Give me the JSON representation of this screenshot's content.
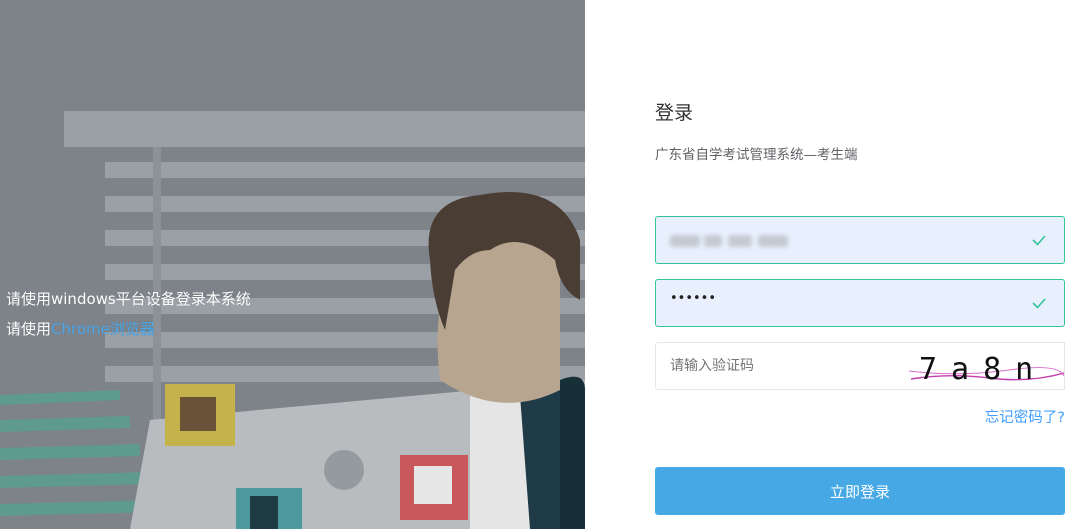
{
  "notice": {
    "line1": "请使用windows平台设备登录本系统",
    "line2_prefix": "请使用",
    "line2_link": "Chrome浏览器"
  },
  "form": {
    "title": "登录",
    "subtitle": "广东省自学考试管理系统—考生端",
    "username_value": "",
    "password_value": "••••••",
    "captcha_placeholder": "请输入验证码",
    "captcha_text": "7a8n",
    "forgot_label": "忘记密码了?",
    "submit_label": "立即登录"
  },
  "colors": {
    "accent": "#46a9e6",
    "valid_border": "#34c49a",
    "link": "#409eff"
  },
  "icons": {
    "valid": "check-icon"
  }
}
